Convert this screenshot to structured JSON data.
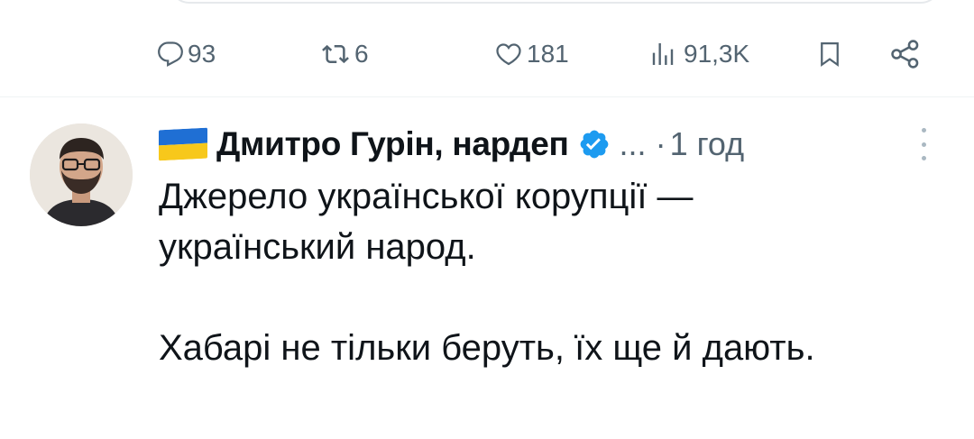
{
  "actions": {
    "replies": "93",
    "retweets": "6",
    "likes": "181",
    "views": "91,3K"
  },
  "tweet": {
    "author": "Дмитро Гурін, нардеп",
    "ellipsis": "...",
    "separator": "·",
    "time": "1 год",
    "flag_colors": [
      "#1f6fd4",
      "#f7c81b"
    ],
    "verified_color": "#1d9bf0",
    "lines": [
      "Джерело української корупції —",
      "український народ.",
      "",
      "Хабарі не тільки беруть, їх ще й дають."
    ]
  }
}
